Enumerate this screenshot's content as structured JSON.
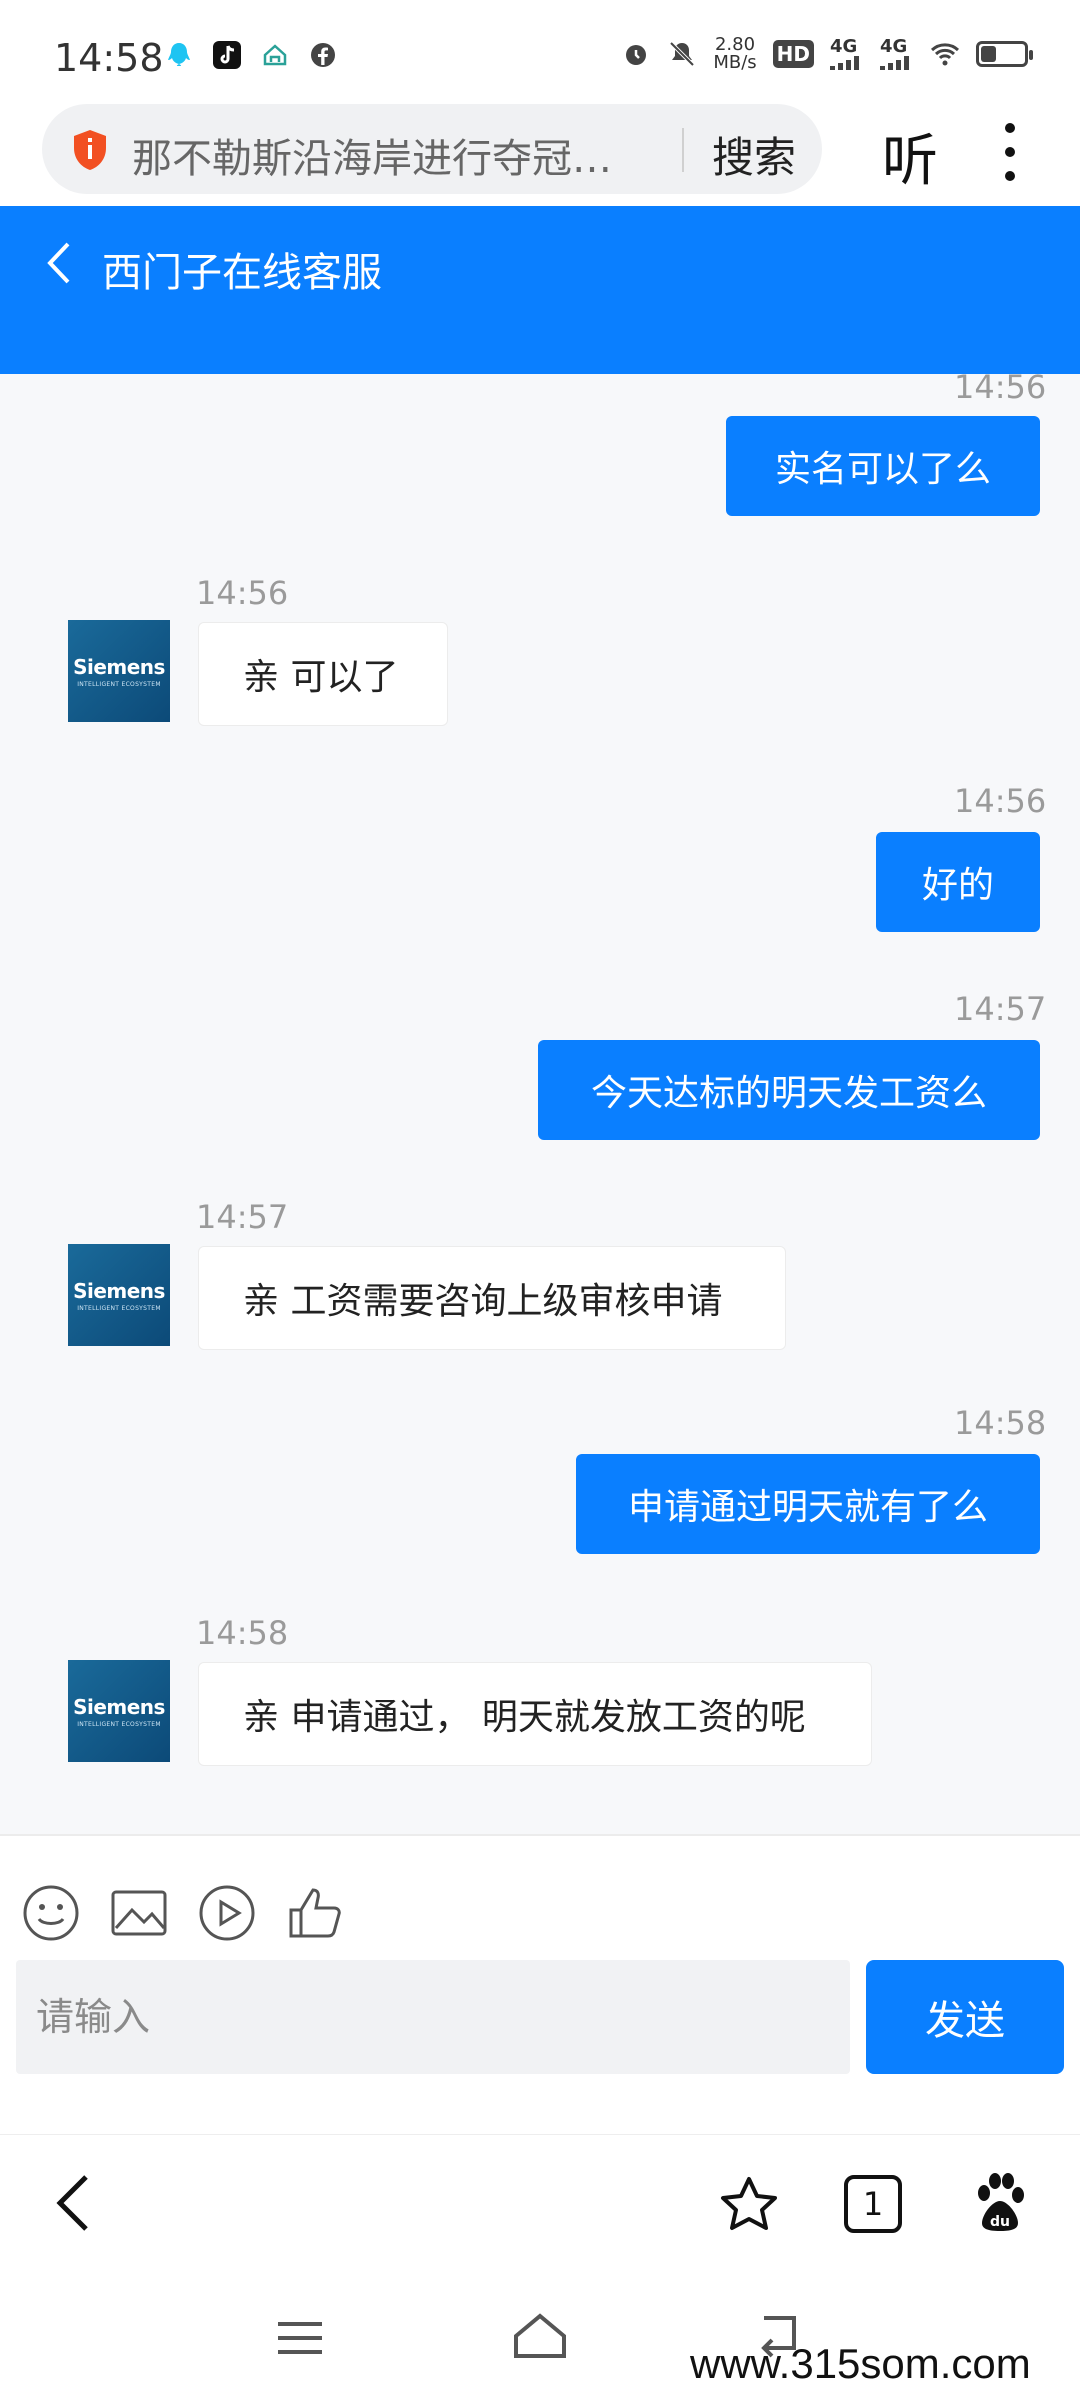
{
  "status_bar": {
    "time": "14:58",
    "speed_value": "2.80",
    "speed_unit": "MB/s",
    "hd_label": "HD",
    "network_1": "4G",
    "network_2": "4G",
    "battery_level": 0.35
  },
  "browser": {
    "url_title": "那不勒斯沿海岸进行夺冠…",
    "search_label": "搜索",
    "listen_label": "听"
  },
  "chat": {
    "title": "西门子在线客服",
    "avatar_brand": "Siemens",
    "avatar_subtitle": "INTELLIGENT ECOSYSTEM",
    "messages": [
      {
        "direction": "out",
        "time": "14:56",
        "text": "实名可以了么"
      },
      {
        "direction": "in",
        "time": "14:56",
        "text": "亲 可以了"
      },
      {
        "direction": "out",
        "time": "14:56",
        "text": "好的"
      },
      {
        "direction": "out",
        "time": "14:57",
        "text": "今天达标的明天发工资么"
      },
      {
        "direction": "in",
        "time": "14:57",
        "text": "亲 工资需要咨询上级审核申请"
      },
      {
        "direction": "out",
        "time": "14:58",
        "text": "申请通过明天就有了么"
      },
      {
        "direction": "in",
        "time": "14:58",
        "text": "亲 申请通过， 明天就发放工资的呢"
      }
    ]
  },
  "composer": {
    "placeholder": "请输入",
    "send_label": "发送",
    "tools": [
      "emoji-icon",
      "image-icon",
      "video-icon",
      "thumbs-up-icon"
    ]
  },
  "browser_nav": {
    "tab_count": "1"
  },
  "watermark": "www.315som.com",
  "colors": {
    "accent": "#0a7fff",
    "background": "#f7f8fa"
  }
}
